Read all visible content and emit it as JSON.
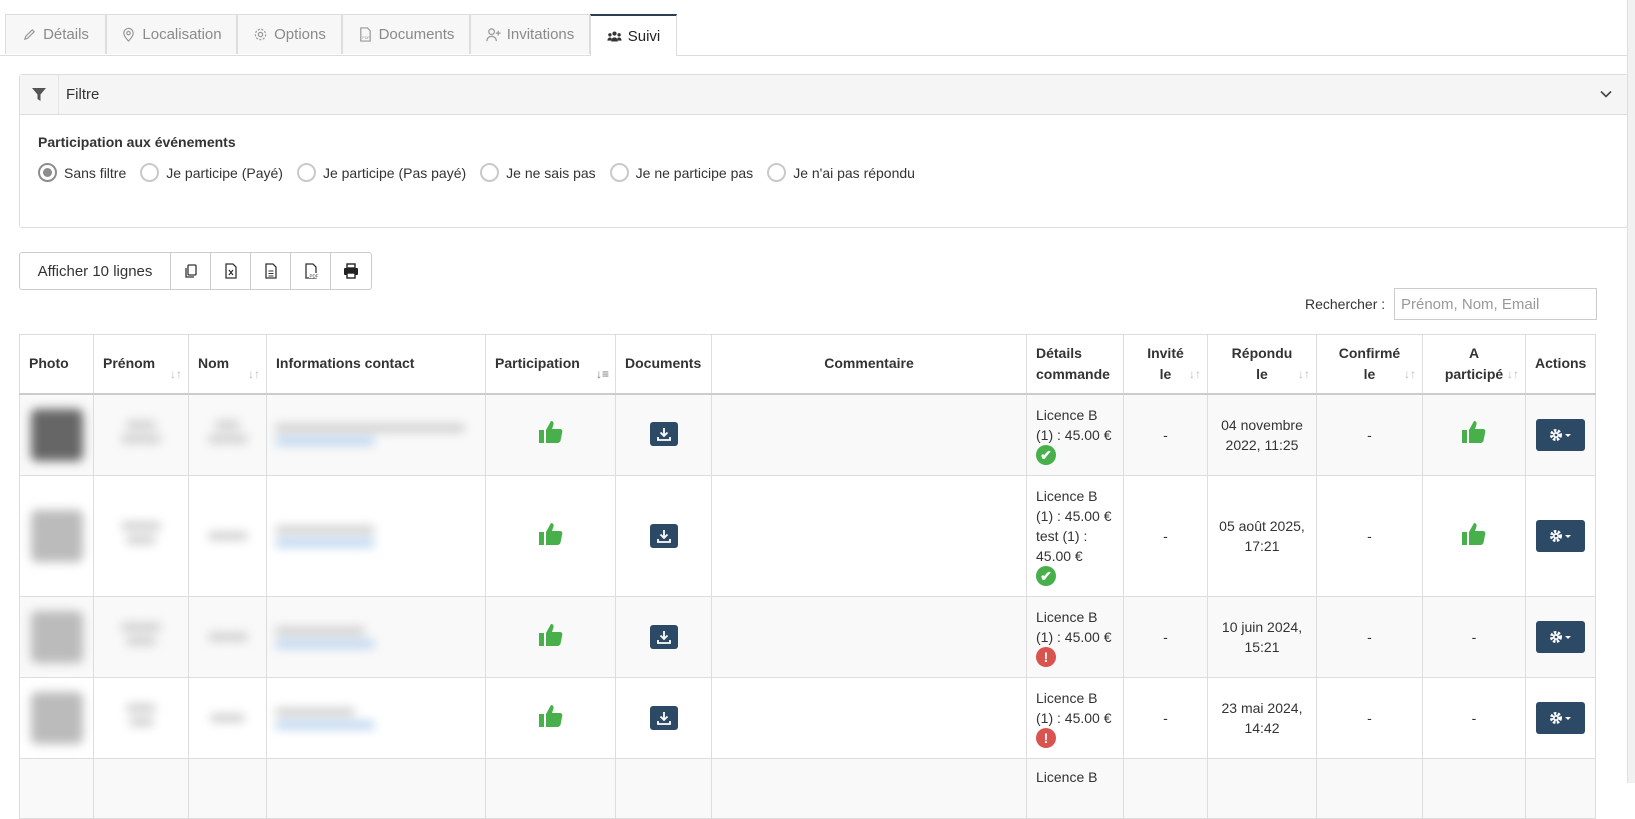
{
  "tabs": [
    {
      "label": "Détails",
      "icon": "pencil-icon",
      "active": false
    },
    {
      "label": "Localisation",
      "icon": "map-pin-icon",
      "active": false
    },
    {
      "label": "Options",
      "icon": "gear-icon",
      "active": false
    },
    {
      "label": "Documents",
      "icon": "pdf-file-icon",
      "active": false
    },
    {
      "label": "Invitations",
      "icon": "user-plus-icon",
      "active": false
    },
    {
      "label": "Suivi",
      "icon": "users-icon",
      "active": true
    }
  ],
  "filter": {
    "title": "Filtre",
    "group_label": "Participation aux événements",
    "options": [
      "Sans filtre",
      "Je participe (Payé)",
      "Je participe (Pas payé)",
      "Je ne sais pas",
      "Je ne participe pas",
      "Je n'ai pas répondu"
    ],
    "selected": "Sans filtre"
  },
  "toolbar": {
    "show_rows": "Afficher 10 lignes",
    "buttons": [
      "copy-icon",
      "excel-icon",
      "csv-icon",
      "pdf-icon",
      "print-icon"
    ]
  },
  "search": {
    "label": "Rechercher :",
    "placeholder": "Prénom, Nom, Email"
  },
  "table": {
    "headers": {
      "photo": "Photo",
      "prenom": "Prénom",
      "nom": "Nom",
      "contact": "Informations contact",
      "participation": "Participation",
      "documents": "Documents",
      "commentaire": "Commentaire",
      "details_l1": "Détails",
      "details_l2": "commande",
      "invite_l1": "Invité",
      "invite_l2": "le",
      "repondu_l1": "Répondu",
      "repondu_l2": "le",
      "confirme_l1": "Confirmé",
      "confirme_l2": "le",
      "aparticipe_l1": "A",
      "aparticipe_l2": "participé",
      "actions": "Actions"
    },
    "rows": [
      {
        "details": [
          "Licence B",
          "(1) : 45.00 €"
        ],
        "paid": true,
        "invite": "-",
        "repondu_l1": "04 novembre",
        "repondu_l2": "2022, 11:25",
        "confirme": "-",
        "a_participe": true
      },
      {
        "details": [
          "Licence B",
          "(1) : 45.00 €",
          "test (1) :",
          "45.00 €"
        ],
        "paid": true,
        "invite": "-",
        "repondu_l1": "05 août 2025,",
        "repondu_l2": "17:21",
        "confirme": "-",
        "a_participe": true
      },
      {
        "details": [
          "Licence B",
          "(1) : 45.00 €"
        ],
        "paid": false,
        "invite": "-",
        "repondu_l1": "10 juin 2024,",
        "repondu_l2": "15:21",
        "confirme": "-",
        "a_participe_text": "-"
      },
      {
        "details": [
          "Licence B",
          "(1) : 45.00 €"
        ],
        "paid": false,
        "invite": "-",
        "repondu_l1": "23 mai 2024,",
        "repondu_l2": "14:42",
        "confirme": "-",
        "a_participe_text": "-"
      },
      {
        "details": [
          "Licence B"
        ]
      }
    ],
    "status_ok_glyph": "✔",
    "status_ko_glyph": "!"
  },
  "colors": {
    "accent": "#2c4966",
    "thumb": "#47b04b",
    "ok": "#47b04b",
    "ko": "#d9534f"
  }
}
